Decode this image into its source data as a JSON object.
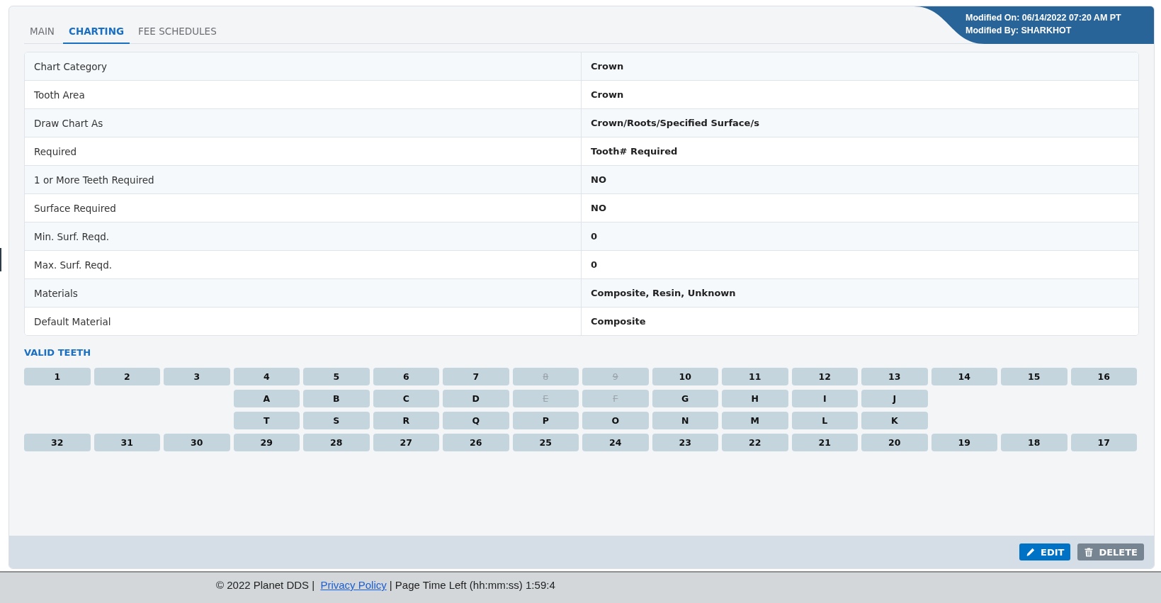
{
  "tabs": [
    {
      "label": "MAIN",
      "selected": false
    },
    {
      "label": "CHARTING",
      "selected": true
    },
    {
      "label": "FEE SCHEDULES",
      "selected": false
    }
  ],
  "modified": {
    "on": "Modified On: 06/14/2022 07:20 AM PT",
    "by": "Modified By: SHARKHOT"
  },
  "details": [
    {
      "label": "Chart Category",
      "value": "Crown"
    },
    {
      "label": "Tooth Area",
      "value": "Crown"
    },
    {
      "label": "Draw Chart As",
      "value": "Crown/Roots/Specified Surface/s"
    },
    {
      "label": "Required",
      "value": "Tooth# Required"
    },
    {
      "label": "1 or More Teeth Required",
      "value": "NO"
    },
    {
      "label": "Surface Required",
      "value": "NO"
    },
    {
      "label": "Min. Surf. Reqd.",
      "value": "0"
    },
    {
      "label": "Max. Surf. Reqd.",
      "value": "0"
    },
    {
      "label": "Materials",
      "value": "Composite, Resin, Unknown"
    },
    {
      "label": "Default Material",
      "value": "Composite"
    }
  ],
  "valid_teeth": {
    "title": "VALID TEETH",
    "rows": [
      {
        "teeth": [
          {
            "label": "1",
            "disabled": false
          },
          {
            "label": "2",
            "disabled": false
          },
          {
            "label": "3",
            "disabled": false
          },
          {
            "label": "4",
            "disabled": false
          },
          {
            "label": "5",
            "disabled": false
          },
          {
            "label": "6",
            "disabled": false
          },
          {
            "label": "7",
            "disabled": false
          },
          {
            "label": "8",
            "disabled": true
          },
          {
            "label": "9",
            "disabled": true
          },
          {
            "label": "10",
            "disabled": false
          },
          {
            "label": "11",
            "disabled": false
          },
          {
            "label": "12",
            "disabled": false
          },
          {
            "label": "13",
            "disabled": false
          },
          {
            "label": "14",
            "disabled": false
          },
          {
            "label": "15",
            "disabled": false
          },
          {
            "label": "16",
            "disabled": false
          }
        ]
      },
      {
        "teeth": [
          {
            "label": "A",
            "disabled": false
          },
          {
            "label": "B",
            "disabled": false
          },
          {
            "label": "C",
            "disabled": false
          },
          {
            "label": "D",
            "disabled": false
          },
          {
            "label": "E",
            "disabled": true
          },
          {
            "label": "F",
            "disabled": true
          },
          {
            "label": "G",
            "disabled": false
          },
          {
            "label": "H",
            "disabled": false
          },
          {
            "label": "I",
            "disabled": false
          },
          {
            "label": "J",
            "disabled": false
          }
        ]
      },
      {
        "teeth": [
          {
            "label": "T",
            "disabled": false
          },
          {
            "label": "S",
            "disabled": false
          },
          {
            "label": "R",
            "disabled": false
          },
          {
            "label": "Q",
            "disabled": false
          },
          {
            "label": "P",
            "disabled": false
          },
          {
            "label": "O",
            "disabled": false
          },
          {
            "label": "N",
            "disabled": false
          },
          {
            "label": "M",
            "disabled": false
          },
          {
            "label": "L",
            "disabled": false
          },
          {
            "label": "K",
            "disabled": false
          }
        ]
      },
      {
        "teeth": [
          {
            "label": "32",
            "disabled": false
          },
          {
            "label": "31",
            "disabled": false
          },
          {
            "label": "30",
            "disabled": false
          },
          {
            "label": "29",
            "disabled": false
          },
          {
            "label": "28",
            "disabled": false
          },
          {
            "label": "27",
            "disabled": false
          },
          {
            "label": "26",
            "disabled": false
          },
          {
            "label": "25",
            "disabled": false
          },
          {
            "label": "24",
            "disabled": false
          },
          {
            "label": "23",
            "disabled": false
          },
          {
            "label": "22",
            "disabled": false
          },
          {
            "label": "21",
            "disabled": false
          },
          {
            "label": "20",
            "disabled": false
          },
          {
            "label": "19",
            "disabled": false
          },
          {
            "label": "18",
            "disabled": false
          },
          {
            "label": "17",
            "disabled": false
          }
        ]
      }
    ]
  },
  "actions": [
    {
      "label": "EDIT",
      "kind": "edit"
    },
    {
      "label": "DELETE",
      "kind": "delete"
    }
  ],
  "footer": {
    "copyright": "© 2022 Planet DDS |",
    "link": "Privacy Policy",
    "time_left": "|  Page Time Left (hh:mm:ss) 1:59:4"
  }
}
